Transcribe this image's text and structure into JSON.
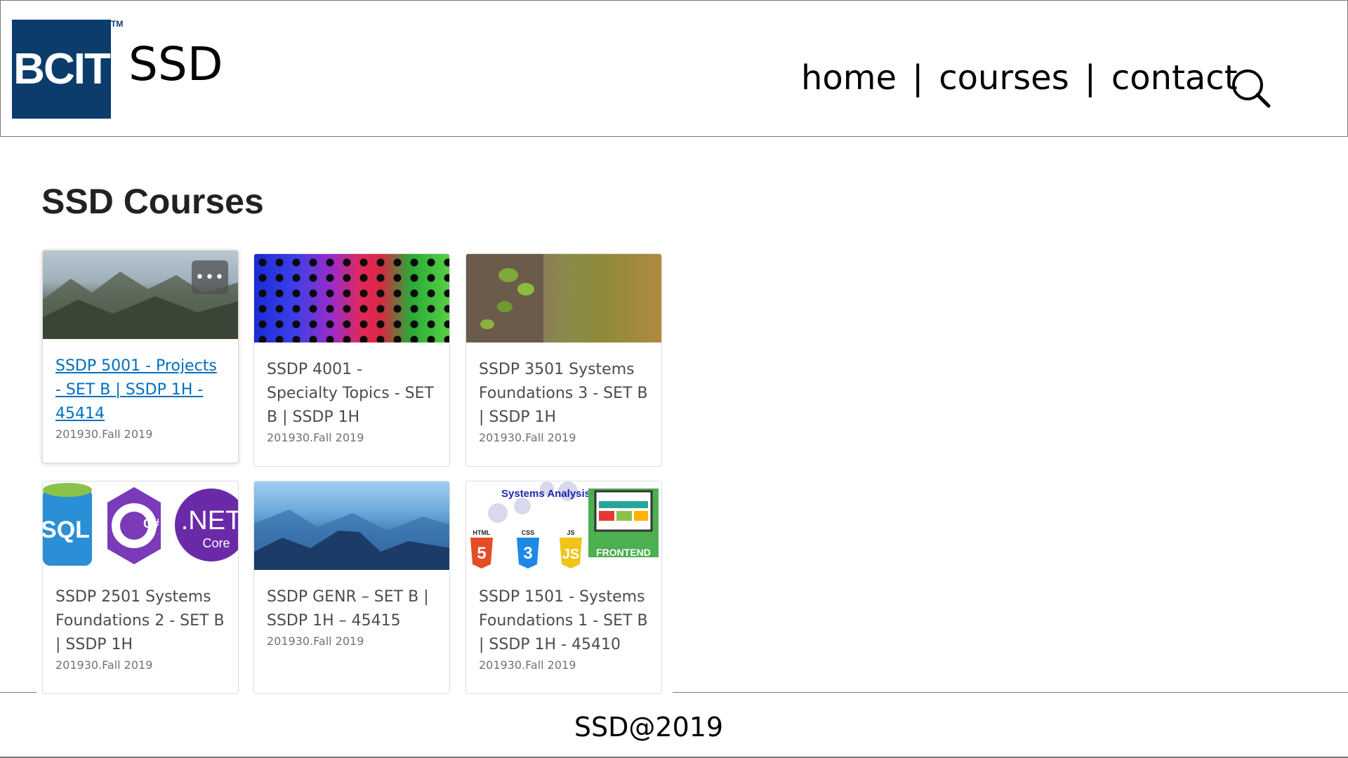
{
  "header": {
    "logo_text": "BCIT",
    "logo_tm": "TM",
    "site_title": "SSD",
    "nav": [
      {
        "label": "home"
      },
      {
        "label": "courses"
      },
      {
        "label": "contact"
      }
    ],
    "nav_separator": "|",
    "search_icon": "search-icon"
  },
  "main": {
    "title": "SSD Courses",
    "courses": [
      {
        "name": "SSDP 5001 - Projects - SET B | SSDP 1H - 45414",
        "term": "201930.Fall 2019",
        "image": "mountain-landscape",
        "more_label": "•••"
      },
      {
        "name": "SSDP 4001 - Specialty Topics - SET B | SSDP 1H",
        "term": "201930.Fall 2019",
        "image": "colored-straws"
      },
      {
        "name": "SSDP 3501 Systems Foundations 3 - SET B | SSDP 1H",
        "term": "201930.Fall 2019",
        "image": "tree-leaves"
      },
      {
        "name": "SSDP 2501 Systems Foundations 2 - SET B | SSDP 1H",
        "term": "201930.Fall 2019",
        "image": "sql-csharp-dotnet",
        "thumb_text": {
          "sql": "SQL",
          "csharp": "C#",
          "dotnet": ".NET",
          "core": "Core"
        }
      },
      {
        "name": "SSDP GENR – SET B | SSDP 1H – 45415",
        "term": "201930.Fall 2019",
        "image": "blue-mountains"
      },
      {
        "name": "SSDP 1501 - Systems Foundations 1 - SET B | SSDP 1H - 45410",
        "term": "201930.Fall 2019",
        "image": "systems-analysis-frontend",
        "thumb_text": {
          "sad": "Systems Analysis and Design",
          "html": "HTML",
          "css": "CSS",
          "js": "JS",
          "frontend": "FRONTEND",
          "n5": "5",
          "n3": "3",
          "js_glyph": "JS"
        }
      }
    ]
  },
  "footer": {
    "text": "SSD@2019"
  }
}
